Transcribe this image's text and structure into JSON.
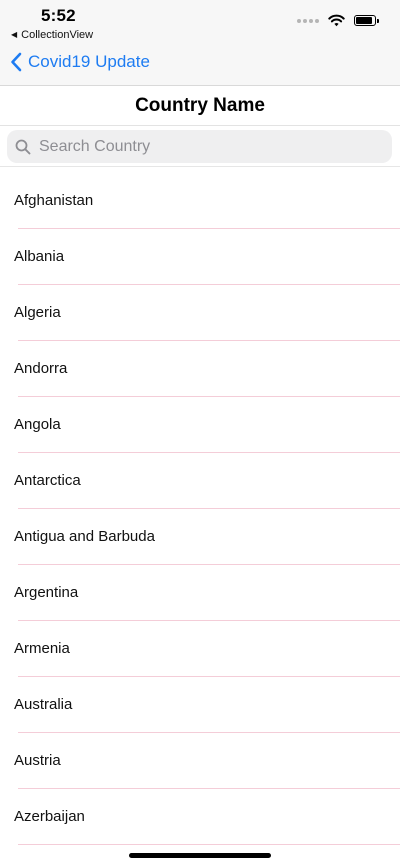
{
  "status_bar": {
    "time": "5:52",
    "back_app_label": "CollectionView",
    "back_app_icon": "left-triangle",
    "signal_icon": "cellular-dots",
    "wifi_icon": "wifi",
    "battery_icon": "battery",
    "battery_level": 0.9
  },
  "nav": {
    "back_label": "Covid19 Update",
    "back_icon": "chevron-left",
    "accent_color": "#1e7cf2"
  },
  "header": {
    "title": "Country Name"
  },
  "search": {
    "placeholder": "Search Country",
    "value": "",
    "icon": "magnifier"
  },
  "countries": [
    "Afghanistan",
    "Albania",
    "Algeria",
    "Andorra",
    "Angola",
    "Antarctica",
    "Antigua and Barbuda",
    "Argentina",
    "Armenia",
    "Australia",
    "Austria",
    "Azerbaijan"
  ],
  "colors": {
    "separator": "#f4cdd8",
    "background": "#ffffff"
  }
}
